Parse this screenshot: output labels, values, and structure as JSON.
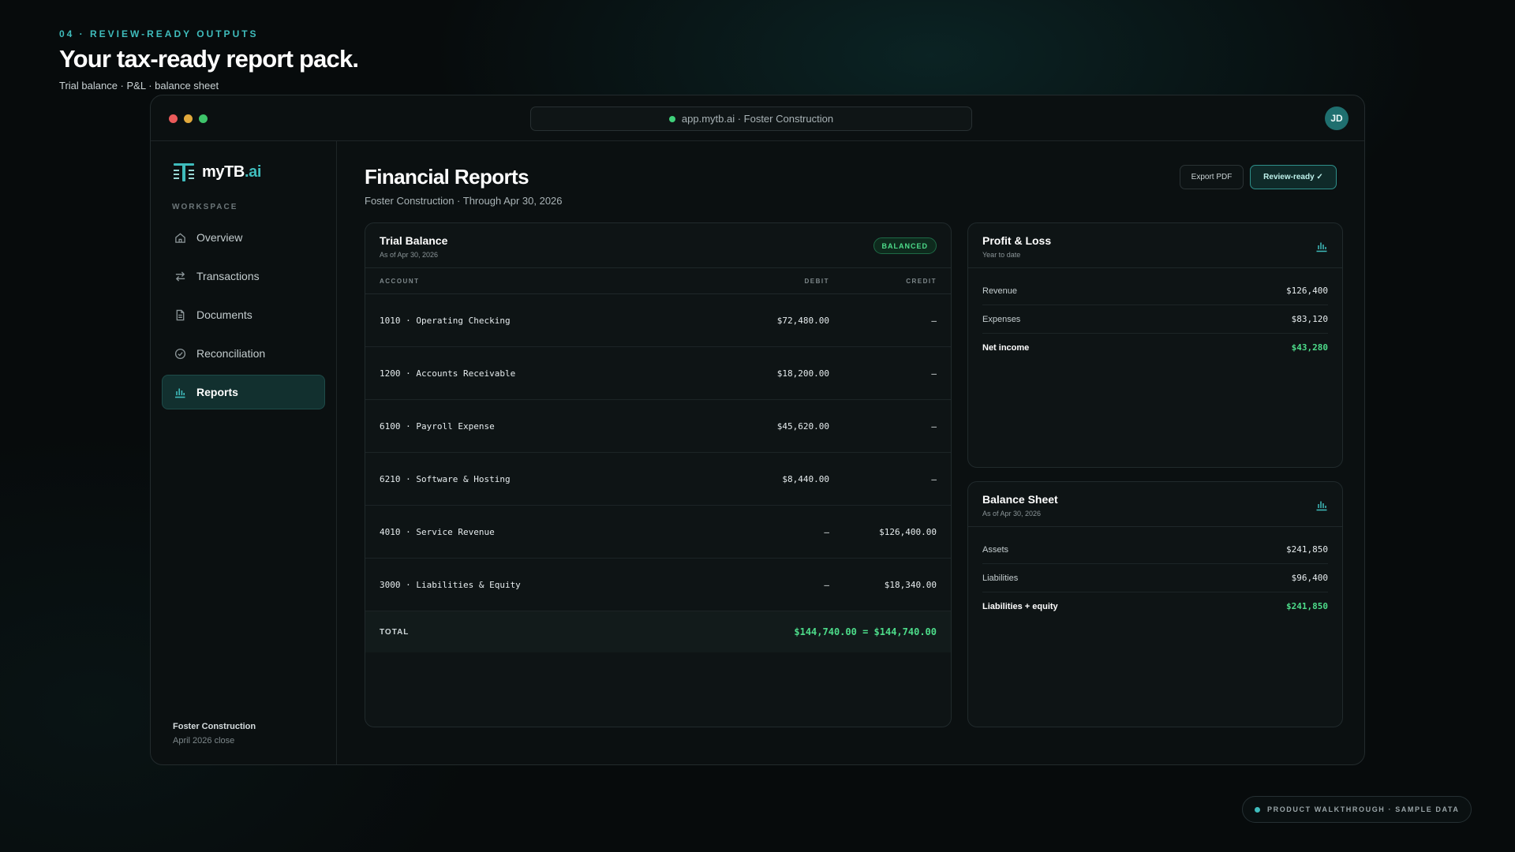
{
  "hero": {
    "eyebrow": "04 · REVIEW-READY OUTPUTS",
    "title": "Your tax-ready report pack.",
    "subtitle": "Trial balance · P&L · balance sheet"
  },
  "browser": {
    "url": "app.mytb.ai · Foster Construction",
    "avatar_initials": "JD"
  },
  "sidebar": {
    "logo_main": "myTB",
    "logo_accent": ".ai",
    "workspace_label": "WORKSPACE",
    "items": [
      {
        "label": "Overview",
        "icon": "home-icon"
      },
      {
        "label": "Transactions",
        "icon": "swap-arrows-icon"
      },
      {
        "label": "Documents",
        "icon": "document-icon"
      },
      {
        "label": "Reconciliation",
        "icon": "check-circle-icon"
      },
      {
        "label": "Reports",
        "icon": "bar-chart-icon",
        "active": true
      }
    ],
    "footer": {
      "company": "Foster Construction",
      "period": "April 2026 close"
    }
  },
  "page": {
    "title": "Financial Reports",
    "subtitle": "Foster Construction · Through Apr 30, 2026",
    "export_label": "Export PDF",
    "review_label": "Review-ready ✓"
  },
  "trial_balance": {
    "title": "Trial Balance",
    "subtitle": "As of Apr 30, 2026",
    "badge": "BALANCED",
    "columns": {
      "account": "ACCOUNT",
      "debit": "DEBIT",
      "credit": "CREDIT"
    },
    "rows": [
      {
        "account": "1010 · Operating Checking",
        "debit": "$72,480.00",
        "credit": "—"
      },
      {
        "account": "1200 · Accounts Receivable",
        "debit": "$18,200.00",
        "credit": "—"
      },
      {
        "account": "6100 · Payroll Expense",
        "debit": "$45,620.00",
        "credit": "—"
      },
      {
        "account": "6210 · Software & Hosting",
        "debit": "$8,440.00",
        "credit": "—"
      },
      {
        "account": "4010 · Service Revenue",
        "debit": "—",
        "credit": "$126,400.00"
      },
      {
        "account": "3000 · Liabilities & Equity",
        "debit": "—",
        "credit": "$18,340.00"
      }
    ],
    "total_label": "TOTAL",
    "total_value": "$144,740.00 = $144,740.00"
  },
  "profit_loss": {
    "title": "Profit & Loss",
    "subtitle": "Year to date",
    "rows": [
      {
        "label": "Revenue",
        "value": "$126,400"
      },
      {
        "label": "Expenses",
        "value": "$83,120"
      },
      {
        "label": "Net income",
        "value": "$43,280"
      }
    ]
  },
  "balance_sheet": {
    "title": "Balance Sheet",
    "subtitle": "As of Apr 30, 2026",
    "rows": [
      {
        "label": "Assets",
        "value": "$241,850"
      },
      {
        "label": "Liabilities",
        "value": "$96,400"
      },
      {
        "label": "Liabilities + equity",
        "value": "$241,850"
      }
    ]
  },
  "footer_pill": "PRODUCT WALKTHROUGH · SAMPLE DATA",
  "colors": {
    "accent": "#3fbcbc",
    "positive": "#4ddc8a",
    "background": "#070b0c"
  }
}
